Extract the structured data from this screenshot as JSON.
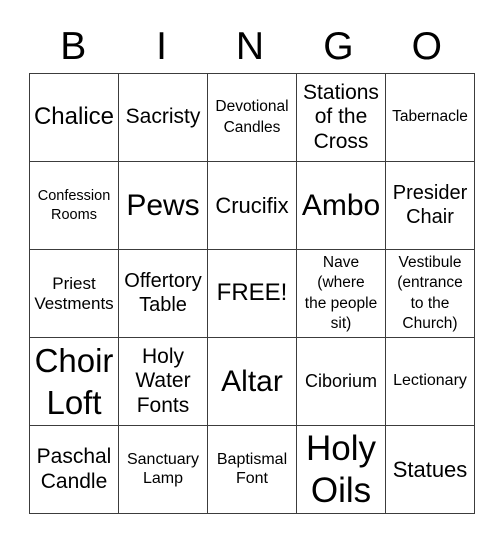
{
  "header": {
    "letters": [
      "B",
      "I",
      "N",
      "G",
      "O"
    ]
  },
  "grid": {
    "rows": [
      [
        "Chalice",
        "Sacristy",
        "Devotional\nCandles",
        "Stations\nof the\nCross",
        "Tabernacle"
      ],
      [
        "Confession\nRooms",
        "Pews",
        "Crucifix",
        "Ambo",
        "Presider\nChair"
      ],
      [
        "Priest\nVestments",
        "Offertory\nTable",
        "FREE!",
        "Nave\n(where\nthe people\nsit)",
        "Vestibule\n(entrance\nto the\nChurch)"
      ],
      [
        "Choir\nLoft",
        "Holy\nWater\nFonts",
        "Altar",
        "Ciborium",
        "Lectionary"
      ],
      [
        "Paschal\nCandle",
        "Sanctuary\nLamp",
        "Baptismal\nFont",
        "Holy\nOils",
        "Statues"
      ]
    ]
  }
}
